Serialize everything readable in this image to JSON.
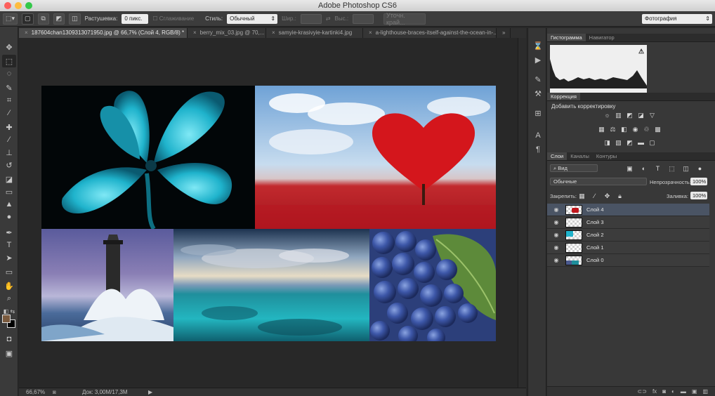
{
  "window": {
    "title": "Adobe Photoshop CS6"
  },
  "options_bar": {
    "feather_label": "Растушевка:",
    "feather_value": "0 пикс.",
    "antialias_label": "Сглаживание",
    "style_label": "Стиль:",
    "style_value": "Обычный",
    "width_label": "Шир.:",
    "height_label": "Выс.:",
    "refine_edge_label": "Уточн. край...",
    "workspace_value": "Фотография"
  },
  "tabs": [
    {
      "label": "187604chan1309313071950.jpg @ 66,7% (Слой 4, RGB/8) *"
    },
    {
      "label": "berry_mix_03.jpg @ 70,..."
    },
    {
      "label": "samyie-krasivyie-kartinki4.jpg"
    },
    {
      "label": "a-lighthouse-braces-itself-against-the-ocean-in-..."
    }
  ],
  "status_bar": {
    "zoom": "66,67%",
    "doc": "Док: 3,00M/17,3M"
  },
  "panels": {
    "histogram_tabs": [
      "Гистограмма",
      "Навигатор"
    ],
    "adjustments_tab": "Коррекция",
    "adjustments_title": "Добавить корректировку",
    "layers_tabs": [
      "Слои",
      "Каналы",
      "Контуры"
    ],
    "kind_filter": "Вид",
    "blend_mode": "Обычные",
    "opacity_label": "Непрозрачность:",
    "opacity_value": "100%",
    "lock_label": "Закрепить:",
    "fill_label": "Заливка:",
    "fill_value": "100%",
    "layers": [
      {
        "name": "Слой 4",
        "active": true
      },
      {
        "name": "Слой 3",
        "active": false
      },
      {
        "name": "Слой 2",
        "active": false
      },
      {
        "name": "Слой 1",
        "active": false
      },
      {
        "name": "Слой 0",
        "active": false
      }
    ]
  },
  "colors": {
    "ui_dark": "#282828",
    "panel": "#383838",
    "active_layer": "#4a5464",
    "foreground_swatch": "#7a5a3e",
    "background_swatch": "#000000"
  }
}
